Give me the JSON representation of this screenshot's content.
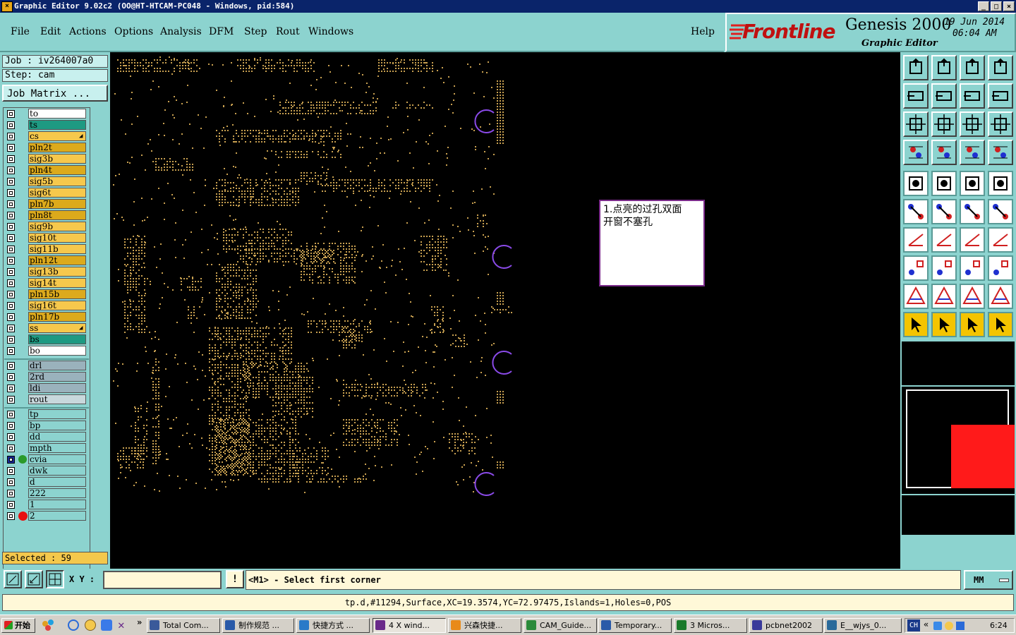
{
  "window": {
    "title": "Graphic Editor 9.02c2 (OO@HT-HTCAM-PC048 - Windows, pid:584)",
    "controls": [
      "_",
      "□",
      "×"
    ]
  },
  "menu": {
    "items": [
      "File",
      "Edit",
      "Actions",
      "Options",
      "Analysis",
      "DFM",
      "Step",
      "Rout",
      "Windows"
    ],
    "help": "Help"
  },
  "brand": {
    "logo": "Frontline",
    "product": "Genesis 2000",
    "subtitle": "Graphic Editor",
    "date": "19 Jun 2014",
    "time": "06:04 AM"
  },
  "job": {
    "job_label": "Job : iv264007a0",
    "step_label": "Step: cam",
    "matrix_button": "Job Matrix ..."
  },
  "layers": {
    "group1": [
      {
        "name": "to",
        "color": "#ffffff"
      },
      {
        "name": "ts",
        "color": "#1e9a82"
      },
      {
        "name": "cs",
        "color": "#f6c84c",
        "mark": true
      },
      {
        "name": "pln2t",
        "color": "#dcaa1c"
      },
      {
        "name": "sig3b",
        "color": "#f6c84c"
      },
      {
        "name": "pln4t",
        "color": "#dcaa1c"
      },
      {
        "name": "sig5b",
        "color": "#f6c84c"
      },
      {
        "name": "sig6t",
        "color": "#f6c84c"
      },
      {
        "name": "pln7b",
        "color": "#dcaa1c"
      },
      {
        "name": "pln8t",
        "color": "#dcaa1c"
      },
      {
        "name": "sig9b",
        "color": "#f6c84c"
      },
      {
        "name": "sig10t",
        "color": "#f6c84c"
      },
      {
        "name": "sig11b",
        "color": "#f6c84c"
      },
      {
        "name": "pln12t",
        "color": "#dcaa1c"
      },
      {
        "name": "sig13b",
        "color": "#f6c84c"
      },
      {
        "name": "sig14t",
        "color": "#f6c84c"
      },
      {
        "name": "pln15b",
        "color": "#dcaa1c"
      },
      {
        "name": "sig16t",
        "color": "#f6c84c"
      },
      {
        "name": "pln17b",
        "color": "#dcaa1c"
      },
      {
        "name": "ss",
        "color": "#f6c84c",
        "mark": true
      },
      {
        "name": "bs",
        "color": "#1e9a82"
      },
      {
        "name": "bo",
        "color": "#ffffff"
      }
    ],
    "group2": [
      {
        "name": "drl",
        "color": "#9ab2bc"
      },
      {
        "name": "2rd",
        "color": "#9ab2bc"
      },
      {
        "name": "ldi",
        "color": "#9ab2bc"
      },
      {
        "name": "rout",
        "color": "#c8d8dc"
      }
    ],
    "group3": [
      {
        "name": "tp",
        "color": "#8cd3cf"
      },
      {
        "name": "bp",
        "color": "#8cd3cf"
      },
      {
        "name": "dd",
        "color": "#8cd3cf"
      },
      {
        "name": "mpth",
        "color": "#8cd3cf"
      },
      {
        "name": "cvia",
        "color": "#8cd3cf",
        "work": true
      },
      {
        "name": "dwk",
        "color": "#8cd3cf"
      },
      {
        "name": "d",
        "color": "#8cd3cf"
      },
      {
        "name": "222",
        "color": "#8cd3cf"
      },
      {
        "name": "1",
        "color": "#8cd3cf"
      },
      {
        "name": "2",
        "color": "#8cd3cf",
        "red": true
      }
    ]
  },
  "selected": "Selected : 59",
  "note": {
    "line1": "1.点亮的过孔双面",
    "line2": "开窗不塞孔"
  },
  "command": {
    "xy_label": "X Y :",
    "xy_value": "",
    "prompt": "<M1> - Select first corner",
    "units": "MM"
  },
  "status": "tp.d,#11294,Surface,XC=19.3574,YC=72.97475,Islands=1,Holes=0,POS",
  "taskbar": {
    "start": "开始",
    "tasks": [
      {
        "label": "Total Com...",
        "icon": "#3a5a9a"
      },
      {
        "label": "制作规范 ...",
        "icon": "#2a5aa8"
      },
      {
        "label": "快捷方式 ...",
        "icon": "#2a7ac8"
      },
      {
        "label": "4 X wind...",
        "icon": "#6a2a8a",
        "active": true
      },
      {
        "label": "兴森快捷...",
        "icon": "#e88a1a"
      },
      {
        "label": "CAM_Guide...",
        "icon": "#2a8a3a"
      },
      {
        "label": "Temporary...",
        "icon": "#2a5aa8"
      },
      {
        "label": "3 Micros...",
        "icon": "#1a7a2a"
      },
      {
        "label": "pcbnet2002",
        "icon": "#3a3a9a"
      },
      {
        "label": "E__wjys_0...",
        "icon": "#2a6a9a"
      }
    ],
    "lang": "CH",
    "clock": "6:24"
  },
  "colors": {
    "panel": "#8cd3cf",
    "canvas": "#000000",
    "dots": "#c8a050",
    "via_arc": "#8a4ae8",
    "title_bar": "#0a246a"
  }
}
